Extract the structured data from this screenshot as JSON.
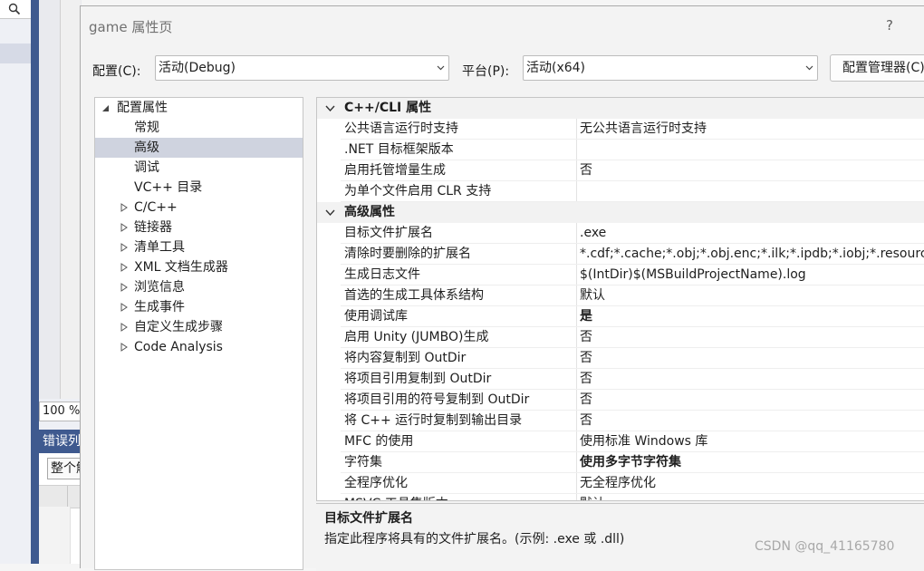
{
  "background": {
    "zoom_level": "100 %",
    "error_panel_title": "错误列表",
    "scope_combo_value": "整个解决方案"
  },
  "dialog": {
    "title": "game 属性页",
    "help_label": "?",
    "config_label": "配置(C):",
    "config_value": "活动(Debug)",
    "platform_label": "平台(P):",
    "platform_value": "活动(x64)",
    "config_manager_label": "配置管理器(C)..."
  },
  "tree": {
    "root": "配置属性",
    "items": [
      {
        "label": "常规",
        "expandable": false,
        "selected": false
      },
      {
        "label": "高级",
        "expandable": false,
        "selected": true
      },
      {
        "label": "调试",
        "expandable": false,
        "selected": false
      },
      {
        "label": "VC++ 目录",
        "expandable": false,
        "selected": false
      },
      {
        "label": "C/C++",
        "expandable": true,
        "selected": false
      },
      {
        "label": "链接器",
        "expandable": true,
        "selected": false
      },
      {
        "label": "清单工具",
        "expandable": true,
        "selected": false
      },
      {
        "label": "XML 文档生成器",
        "expandable": true,
        "selected": false
      },
      {
        "label": "浏览信息",
        "expandable": true,
        "selected": false
      },
      {
        "label": "生成事件",
        "expandable": true,
        "selected": false
      },
      {
        "label": "自定义生成步骤",
        "expandable": true,
        "selected": false
      },
      {
        "label": "Code Analysis",
        "expandable": true,
        "selected": false
      }
    ]
  },
  "grid": {
    "categories": [
      {
        "name": "C++/CLI 属性",
        "rows": [
          {
            "name": "公共语言运行时支持",
            "value": "无公共语言运行时支持",
            "bold": false
          },
          {
            "name": ".NET 目标框架版本",
            "value": "",
            "bold": false
          },
          {
            "name": "启用托管增量生成",
            "value": "否",
            "bold": false
          },
          {
            "name": "为单个文件启用 CLR 支持",
            "value": "",
            "bold": false
          }
        ]
      },
      {
        "name": "高级属性",
        "rows": [
          {
            "name": "目标文件扩展名",
            "value": ".exe",
            "bold": false
          },
          {
            "name": "清除时要删除的扩展名",
            "value": "*.cdf;*.cache;*.obj;*.obj.enc;*.ilk;*.ipdb;*.iobj;*.resources;*.tlb;*.tli;*.tlh;*.tmp;*.rsp;*.pgc;*.pgd;*.meta;*.tlog;*.manifest;*.res;*.pch;*.exp;*.idb;*.rep;*.xdc;*.pdb;*_manifest.rc;*.bsc;*.sbr;*.xml;*.metagen;*.bi",
            "bold": false
          },
          {
            "name": "生成日志文件",
            "value": "$(IntDir)$(MSBuildProjectName).log",
            "bold": false
          },
          {
            "name": "首选的生成工具体系结构",
            "value": "默认",
            "bold": false
          },
          {
            "name": "使用调试库",
            "value": "是",
            "bold": true
          },
          {
            "name": "启用 Unity (JUMBO)生成",
            "value": "否",
            "bold": false
          },
          {
            "name": "将内容复制到 OutDir",
            "value": "否",
            "bold": false
          },
          {
            "name": "将项目引用复制到 OutDir",
            "value": "否",
            "bold": false
          },
          {
            "name": "将项目引用的符号复制到 OutDir",
            "value": "否",
            "bold": false
          },
          {
            "name": "将 C++ 运行时复制到输出目录",
            "value": "否",
            "bold": false
          },
          {
            "name": "MFC 的使用",
            "value": "使用标准 Windows 库",
            "bold": false
          },
          {
            "name": "字符集",
            "value": "使用多字节字符集",
            "bold": true
          },
          {
            "name": "全程序优化",
            "value": "无全程序优化",
            "bold": false
          },
          {
            "name": "MSVC 工具集版本",
            "value": "默认",
            "bold": false
          }
        ]
      }
    ]
  },
  "description": {
    "title": "目标文件扩展名",
    "text": "指定此程序将具有的文件扩展名。(示例: .exe 或 .dll)"
  },
  "watermark": "CSDN @qq_41165780",
  "icons": {
    "search": "search-icon",
    "dropdown": "chevron-down-icon",
    "expanded": "triangle-expanded-icon",
    "collapsed": "triangle-collapsed-icon"
  }
}
